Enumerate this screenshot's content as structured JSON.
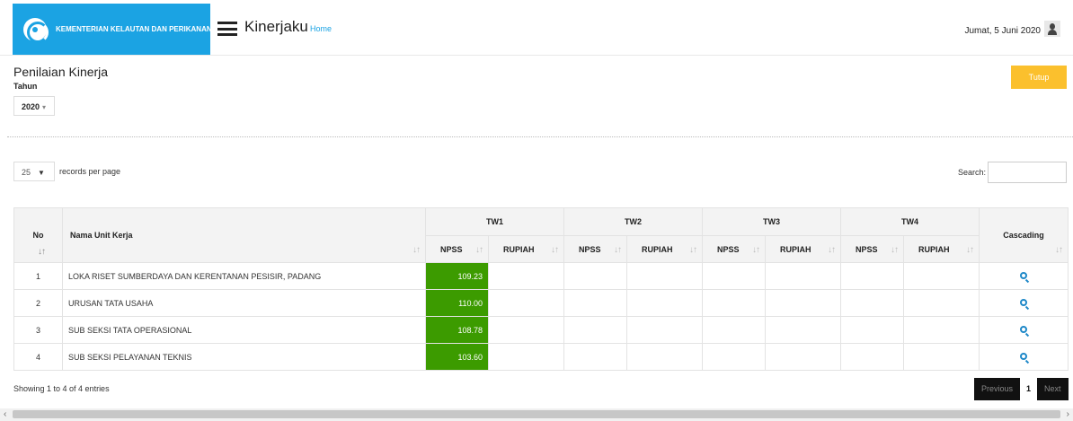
{
  "header": {
    "brand": "KEMENTERIAN KELAUTAN DAN PERIKANAN",
    "app_title": "Kinerjaku",
    "home_link": "Home",
    "date": "Jumat, 5 Juni 2020"
  },
  "page": {
    "title": "Penilaian Kinerja",
    "year_label": "Tahun",
    "year_value": "2020",
    "close_button": "Tutup"
  },
  "controls": {
    "records_per_page_value": "25",
    "records_per_page_label": "records per page",
    "search_label": "Search:",
    "search_value": ""
  },
  "table": {
    "headers": {
      "no": "No",
      "nama": "Nama Unit Kerja",
      "cascading": "Cascading",
      "groups": [
        "TW1",
        "TW2",
        "TW3",
        "TW4"
      ],
      "sub_npss": "NPSS",
      "sub_rupiah": "RUPIAH"
    },
    "rows": [
      {
        "no": "1",
        "nama": "LOKA RISET SUMBERDAYA DAN KERENTANAN PESISIR, PADANG",
        "tw1_npss": "109.23"
      },
      {
        "no": "2",
        "nama": "URUSAN TATA USAHA",
        "tw1_npss": "110.00"
      },
      {
        "no": "3",
        "nama": "SUB SEKSI TATA OPERASIONAL",
        "tw1_npss": "108.78"
      },
      {
        "no": "4",
        "nama": "SUB SEKSI PELAYANAN TEKNIS",
        "tw1_npss": "103.60"
      }
    ]
  },
  "footer": {
    "info": "Showing 1 to 4 of 4 entries",
    "previous": "Previous",
    "current_page": "1",
    "next": "Next"
  },
  "colors": {
    "brand_blue": "#1ba3e3",
    "npss_green": "#3c9b00",
    "tutup_yellow": "#fbc02d"
  }
}
